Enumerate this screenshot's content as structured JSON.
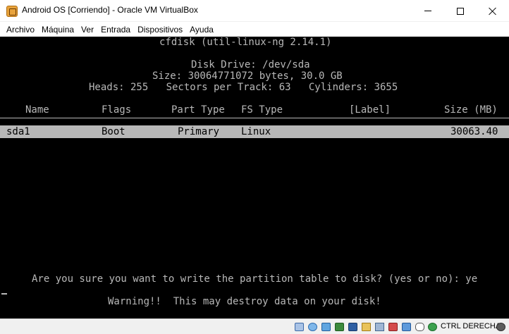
{
  "window": {
    "title": "Android OS [Corriendo] - Oracle VM VirtualBox"
  },
  "menu": {
    "items": [
      "Archivo",
      "Máquina",
      "Ver",
      "Entrada",
      "Dispositivos",
      "Ayuda"
    ]
  },
  "console": {
    "header": "cfdisk (util-linux-ng 2.14.1)",
    "disk_drive": "Disk Drive: /dev/sda",
    "size": "Size: 30064771072 bytes, 30.0 GB",
    "geometry": "Heads: 255   Sectors per Track: 63   Cylinders: 3655",
    "columns": {
      "name": "Name",
      "flags": "Flags",
      "part_type": "Part Type",
      "fs_type": "FS Type",
      "label": "[Label]",
      "size": "Size (MB)"
    },
    "partition": {
      "name": "sda1",
      "flags": "Boot",
      "part_type": "Primary",
      "fs_type": "Linux",
      "size": "30063.40"
    },
    "prompt": "Are you sure you want to write the partition table to disk? (yes or no): ye",
    "warning": "Warning!!  This may destroy data on your disk!"
  },
  "statusbar": {
    "host_key": "CTRL DERECHA",
    "icons": [
      "hard-disk-icon",
      "optical-drive-icon",
      "audio-icon",
      "network-icon",
      "usb-icon",
      "shared-folder-icon",
      "display-icon",
      "video-capture-icon",
      "cpu-icon",
      "mouse-integration-icon",
      "keyboard-icon",
      "arrow-down-icon"
    ]
  }
}
